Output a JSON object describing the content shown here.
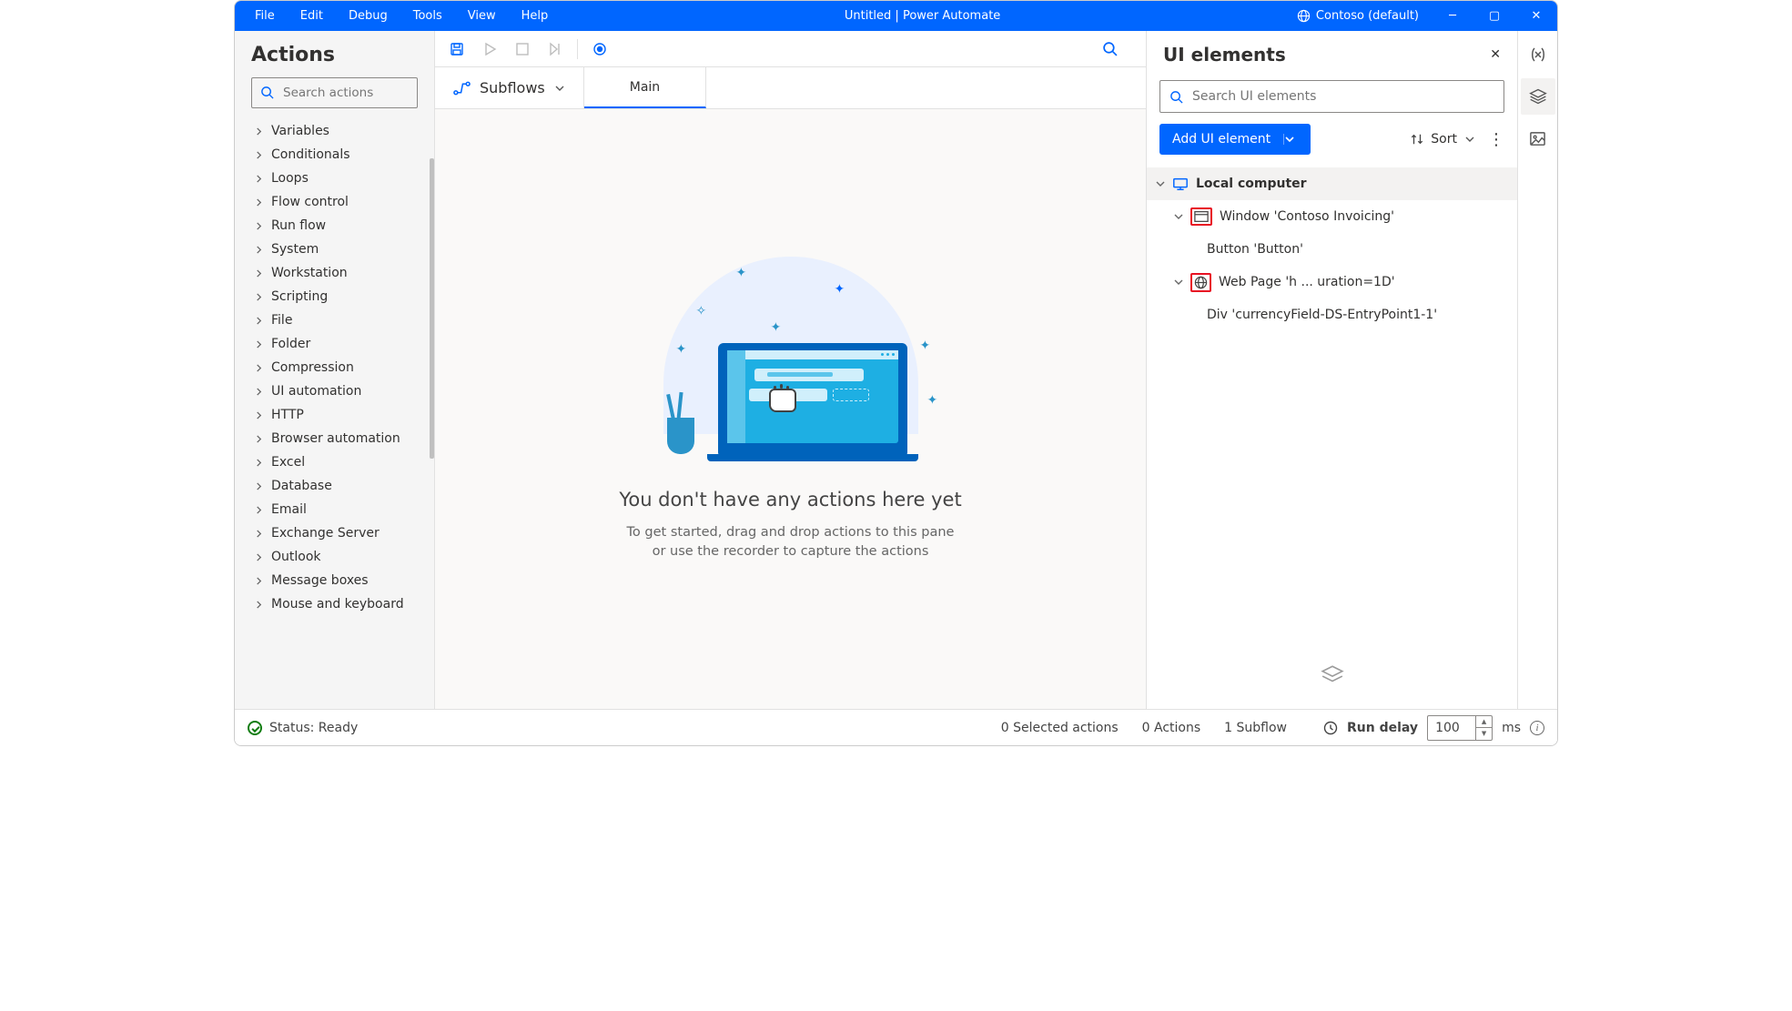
{
  "titlebar": {
    "menu": [
      "File",
      "Edit",
      "Debug",
      "Tools",
      "View",
      "Help"
    ],
    "title": "Untitled | Power Automate",
    "tenant": "Contoso (default)"
  },
  "actions": {
    "heading": "Actions",
    "search_placeholder": "Search actions",
    "categories": [
      "Variables",
      "Conditionals",
      "Loops",
      "Flow control",
      "Run flow",
      "System",
      "Workstation",
      "Scripting",
      "File",
      "Folder",
      "Compression",
      "UI automation",
      "HTTP",
      "Browser automation",
      "Excel",
      "Database",
      "Email",
      "Exchange Server",
      "Outlook",
      "Message boxes",
      "Mouse and keyboard"
    ]
  },
  "subflows": {
    "label": "Subflows",
    "tabs": [
      "Main"
    ]
  },
  "canvas": {
    "title": "You don't have any actions here yet",
    "sub1": "To get started, drag and drop actions to this pane",
    "sub2": "or use the recorder to capture the actions"
  },
  "ui_elements": {
    "heading": "UI elements",
    "search_placeholder": "Search UI elements",
    "add_label": "Add UI element",
    "sort_label": "Sort",
    "tree": {
      "root": "Local computer",
      "children": [
        {
          "label": "Window 'Contoso Invoicing'",
          "icon": "window",
          "children": [
            "Button 'Button'"
          ]
        },
        {
          "label": "Web Page 'h ... uration=1D'",
          "icon": "globe",
          "children": [
            "Div 'currencyField-DS-EntryPoint1-1'"
          ]
        }
      ]
    }
  },
  "statusbar": {
    "status": "Status: Ready",
    "selected": "0 Selected actions",
    "actions_count": "0 Actions",
    "subflow_count": "1 Subflow",
    "delay_label": "Run delay",
    "delay_value": "100",
    "delay_unit": "ms"
  }
}
